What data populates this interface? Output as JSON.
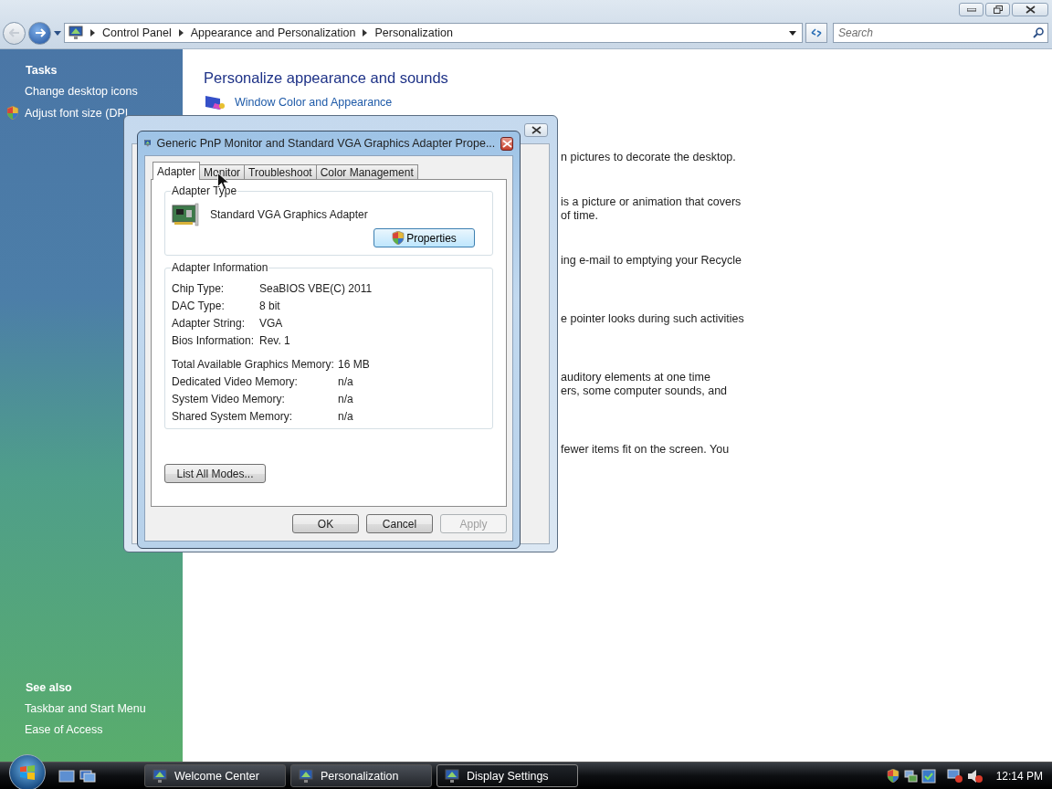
{
  "window": {
    "breadcrumb": [
      "Control Panel",
      "Appearance and Personalization",
      "Personalization"
    ],
    "search": {
      "placeholder": "Search"
    }
  },
  "sidebar": {
    "tasks_heading": "Tasks",
    "tasks": [
      {
        "label": "Change desktop icons",
        "kind": "link"
      },
      {
        "label": "Adjust font size (DPI",
        "kind": "shield"
      }
    ],
    "see_also_heading": "See also",
    "see_also": [
      "Taskbar and Start Menu",
      "Ease of Access"
    ]
  },
  "content": {
    "title": "Personalize appearance and sounds",
    "first_link": "Window Color and Appearance",
    "fragments": [
      [
        "n pictures to decorate the desktop."
      ],
      [
        "is a picture or animation that covers",
        "of time."
      ],
      [
        "ing e-mail to emptying your Recycle"
      ],
      [
        "e pointer looks during such activities"
      ],
      [
        "auditory elements at one time",
        "ers, some computer sounds, and"
      ],
      [
        "fewer items fit on the screen. You"
      ]
    ]
  },
  "dialog": {
    "title": "Generic PnP Monitor and Standard VGA Graphics Adapter Prope...",
    "tabs": [
      {
        "label": "Adapter",
        "selected": true
      },
      {
        "label": "Monitor",
        "selected": false
      },
      {
        "label": "Troubleshoot",
        "selected": false
      },
      {
        "label": "Color Management",
        "selected": false
      }
    ],
    "adapter_type": {
      "legend": "Adapter Type",
      "name": "Standard VGA Graphics Adapter",
      "button": "Properties"
    },
    "info": {
      "legend": "Adapter Information",
      "rows": [
        {
          "label": "Chip Type:",
          "value": "SeaBIOS VBE(C) 2011"
        },
        {
          "label": "DAC Type:",
          "value": "8 bit"
        },
        {
          "label": "Adapter String:",
          "value": "VGA"
        },
        {
          "label": "Bios Information:",
          "value": "Rev. 1"
        }
      ],
      "memory_rows": [
        {
          "label": "Total Available Graphics Memory:",
          "value": "16 MB"
        },
        {
          "label": "Dedicated Video Memory:",
          "value": "n/a"
        },
        {
          "label": "System Video Memory:",
          "value": "n/a"
        },
        {
          "label": "Shared System Memory:",
          "value": "n/a"
        }
      ]
    },
    "list_modes": "List All Modes...",
    "buttons": [
      {
        "label": "OK",
        "disabled": false
      },
      {
        "label": "Cancel",
        "disabled": false
      },
      {
        "label": "Apply",
        "disabled": true
      }
    ]
  },
  "taskbar": {
    "items": [
      {
        "label": "Welcome Center",
        "selected": false
      },
      {
        "label": "Personalization",
        "selected": false
      },
      {
        "label": "Display Settings",
        "selected": true
      }
    ],
    "clock": "12:14 PM"
  }
}
